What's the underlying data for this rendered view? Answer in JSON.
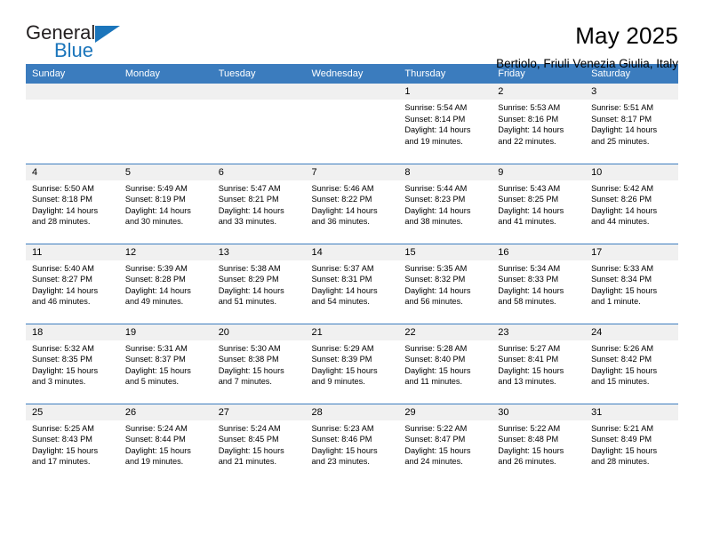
{
  "logo": {
    "word1": "General",
    "word2": "Blue",
    "accent_color": "#1b75bb"
  },
  "header": {
    "title": "May 2025",
    "subtitle": "Bertiolo, Friuli Venezia Giulia, Italy"
  },
  "theme": {
    "header_bg": "#3b7cbe",
    "daynum_bg": "#f0f0f0",
    "grid_line": "#3b7cbe"
  },
  "weekdays": [
    "Sunday",
    "Monday",
    "Tuesday",
    "Wednesday",
    "Thursday",
    "Friday",
    "Saturday"
  ],
  "labels": {
    "sunrise": "Sunrise:",
    "sunset": "Sunset:",
    "daylight": "Daylight:"
  },
  "weeks": [
    [
      {
        "day": ""
      },
      {
        "day": ""
      },
      {
        "day": ""
      },
      {
        "day": ""
      },
      {
        "day": "1",
        "sunrise": "Sunrise: 5:54 AM",
        "sunset": "Sunset: 8:14 PM",
        "daylight_1": "Daylight: 14 hours",
        "daylight_2": "and 19 minutes."
      },
      {
        "day": "2",
        "sunrise": "Sunrise: 5:53 AM",
        "sunset": "Sunset: 8:16 PM",
        "daylight_1": "Daylight: 14 hours",
        "daylight_2": "and 22 minutes."
      },
      {
        "day": "3",
        "sunrise": "Sunrise: 5:51 AM",
        "sunset": "Sunset: 8:17 PM",
        "daylight_1": "Daylight: 14 hours",
        "daylight_2": "and 25 minutes."
      }
    ],
    [
      {
        "day": "4",
        "sunrise": "Sunrise: 5:50 AM",
        "sunset": "Sunset: 8:18 PM",
        "daylight_1": "Daylight: 14 hours",
        "daylight_2": "and 28 minutes."
      },
      {
        "day": "5",
        "sunrise": "Sunrise: 5:49 AM",
        "sunset": "Sunset: 8:19 PM",
        "daylight_1": "Daylight: 14 hours",
        "daylight_2": "and 30 minutes."
      },
      {
        "day": "6",
        "sunrise": "Sunrise: 5:47 AM",
        "sunset": "Sunset: 8:21 PM",
        "daylight_1": "Daylight: 14 hours",
        "daylight_2": "and 33 minutes."
      },
      {
        "day": "7",
        "sunrise": "Sunrise: 5:46 AM",
        "sunset": "Sunset: 8:22 PM",
        "daylight_1": "Daylight: 14 hours",
        "daylight_2": "and 36 minutes."
      },
      {
        "day": "8",
        "sunrise": "Sunrise: 5:44 AM",
        "sunset": "Sunset: 8:23 PM",
        "daylight_1": "Daylight: 14 hours",
        "daylight_2": "and 38 minutes."
      },
      {
        "day": "9",
        "sunrise": "Sunrise: 5:43 AM",
        "sunset": "Sunset: 8:25 PM",
        "daylight_1": "Daylight: 14 hours",
        "daylight_2": "and 41 minutes."
      },
      {
        "day": "10",
        "sunrise": "Sunrise: 5:42 AM",
        "sunset": "Sunset: 8:26 PM",
        "daylight_1": "Daylight: 14 hours",
        "daylight_2": "and 44 minutes."
      }
    ],
    [
      {
        "day": "11",
        "sunrise": "Sunrise: 5:40 AM",
        "sunset": "Sunset: 8:27 PM",
        "daylight_1": "Daylight: 14 hours",
        "daylight_2": "and 46 minutes."
      },
      {
        "day": "12",
        "sunrise": "Sunrise: 5:39 AM",
        "sunset": "Sunset: 8:28 PM",
        "daylight_1": "Daylight: 14 hours",
        "daylight_2": "and 49 minutes."
      },
      {
        "day": "13",
        "sunrise": "Sunrise: 5:38 AM",
        "sunset": "Sunset: 8:29 PM",
        "daylight_1": "Daylight: 14 hours",
        "daylight_2": "and 51 minutes."
      },
      {
        "day": "14",
        "sunrise": "Sunrise: 5:37 AM",
        "sunset": "Sunset: 8:31 PM",
        "daylight_1": "Daylight: 14 hours",
        "daylight_2": "and 54 minutes."
      },
      {
        "day": "15",
        "sunrise": "Sunrise: 5:35 AM",
        "sunset": "Sunset: 8:32 PM",
        "daylight_1": "Daylight: 14 hours",
        "daylight_2": "and 56 minutes."
      },
      {
        "day": "16",
        "sunrise": "Sunrise: 5:34 AM",
        "sunset": "Sunset: 8:33 PM",
        "daylight_1": "Daylight: 14 hours",
        "daylight_2": "and 58 minutes."
      },
      {
        "day": "17",
        "sunrise": "Sunrise: 5:33 AM",
        "sunset": "Sunset: 8:34 PM",
        "daylight_1": "Daylight: 15 hours",
        "daylight_2": "and 1 minute."
      }
    ],
    [
      {
        "day": "18",
        "sunrise": "Sunrise: 5:32 AM",
        "sunset": "Sunset: 8:35 PM",
        "daylight_1": "Daylight: 15 hours",
        "daylight_2": "and 3 minutes."
      },
      {
        "day": "19",
        "sunrise": "Sunrise: 5:31 AM",
        "sunset": "Sunset: 8:37 PM",
        "daylight_1": "Daylight: 15 hours",
        "daylight_2": "and 5 minutes."
      },
      {
        "day": "20",
        "sunrise": "Sunrise: 5:30 AM",
        "sunset": "Sunset: 8:38 PM",
        "daylight_1": "Daylight: 15 hours",
        "daylight_2": "and 7 minutes."
      },
      {
        "day": "21",
        "sunrise": "Sunrise: 5:29 AM",
        "sunset": "Sunset: 8:39 PM",
        "daylight_1": "Daylight: 15 hours",
        "daylight_2": "and 9 minutes."
      },
      {
        "day": "22",
        "sunrise": "Sunrise: 5:28 AM",
        "sunset": "Sunset: 8:40 PM",
        "daylight_1": "Daylight: 15 hours",
        "daylight_2": "and 11 minutes."
      },
      {
        "day": "23",
        "sunrise": "Sunrise: 5:27 AM",
        "sunset": "Sunset: 8:41 PM",
        "daylight_1": "Daylight: 15 hours",
        "daylight_2": "and 13 minutes."
      },
      {
        "day": "24",
        "sunrise": "Sunrise: 5:26 AM",
        "sunset": "Sunset: 8:42 PM",
        "daylight_1": "Daylight: 15 hours",
        "daylight_2": "and 15 minutes."
      }
    ],
    [
      {
        "day": "25",
        "sunrise": "Sunrise: 5:25 AM",
        "sunset": "Sunset: 8:43 PM",
        "daylight_1": "Daylight: 15 hours",
        "daylight_2": "and 17 minutes."
      },
      {
        "day": "26",
        "sunrise": "Sunrise: 5:24 AM",
        "sunset": "Sunset: 8:44 PM",
        "daylight_1": "Daylight: 15 hours",
        "daylight_2": "and 19 minutes."
      },
      {
        "day": "27",
        "sunrise": "Sunrise: 5:24 AM",
        "sunset": "Sunset: 8:45 PM",
        "daylight_1": "Daylight: 15 hours",
        "daylight_2": "and 21 minutes."
      },
      {
        "day": "28",
        "sunrise": "Sunrise: 5:23 AM",
        "sunset": "Sunset: 8:46 PM",
        "daylight_1": "Daylight: 15 hours",
        "daylight_2": "and 23 minutes."
      },
      {
        "day": "29",
        "sunrise": "Sunrise: 5:22 AM",
        "sunset": "Sunset: 8:47 PM",
        "daylight_1": "Daylight: 15 hours",
        "daylight_2": "and 24 minutes."
      },
      {
        "day": "30",
        "sunrise": "Sunrise: 5:22 AM",
        "sunset": "Sunset: 8:48 PM",
        "daylight_1": "Daylight: 15 hours",
        "daylight_2": "and 26 minutes."
      },
      {
        "day": "31",
        "sunrise": "Sunrise: 5:21 AM",
        "sunset": "Sunset: 8:49 PM",
        "daylight_1": "Daylight: 15 hours",
        "daylight_2": "and 28 minutes."
      }
    ]
  ]
}
